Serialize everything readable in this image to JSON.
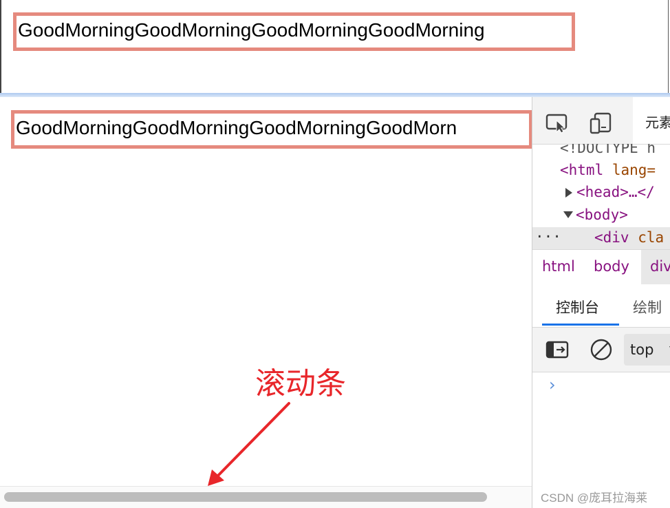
{
  "top_panel": {
    "text": "GoodMorningGoodMorningGoodMorningGoodMorning"
  },
  "bottom_panel": {
    "text": "GoodMorningGoodMorningGoodMorningGoodMorn"
  },
  "annotation": {
    "label": "滚动条",
    "color": "#e8262a"
  },
  "devtools": {
    "toolbar": {
      "inspect_icon": "inspect-element-icon",
      "device_icon": "device-toolbar-icon",
      "elements_tab": "元素"
    },
    "dom": {
      "doctype": "<!DOCTYPE h",
      "html_tag": "<html",
      "html_attr": " lang=",
      "head_tag": "<head>",
      "head_rest": "…</",
      "body_tag": "<body>",
      "selected_prefix": "···",
      "selected_tag": "<div",
      "selected_attr": " cla"
    },
    "breadcrumb": [
      "html",
      "body",
      "div"
    ],
    "drawer_tabs": [
      "控制台",
      "绘制"
    ],
    "console": {
      "context": "top",
      "prompt": "›",
      "sidebar_icon": "sidebar-toggle-icon",
      "clear_icon": "clear-console-icon"
    }
  },
  "watermark": "CSDN @庞耳拉海莱",
  "colors": {
    "box_border": "#e58a7e",
    "tag": "#881280",
    "attr": "#994500",
    "accent": "#1a73e8"
  }
}
